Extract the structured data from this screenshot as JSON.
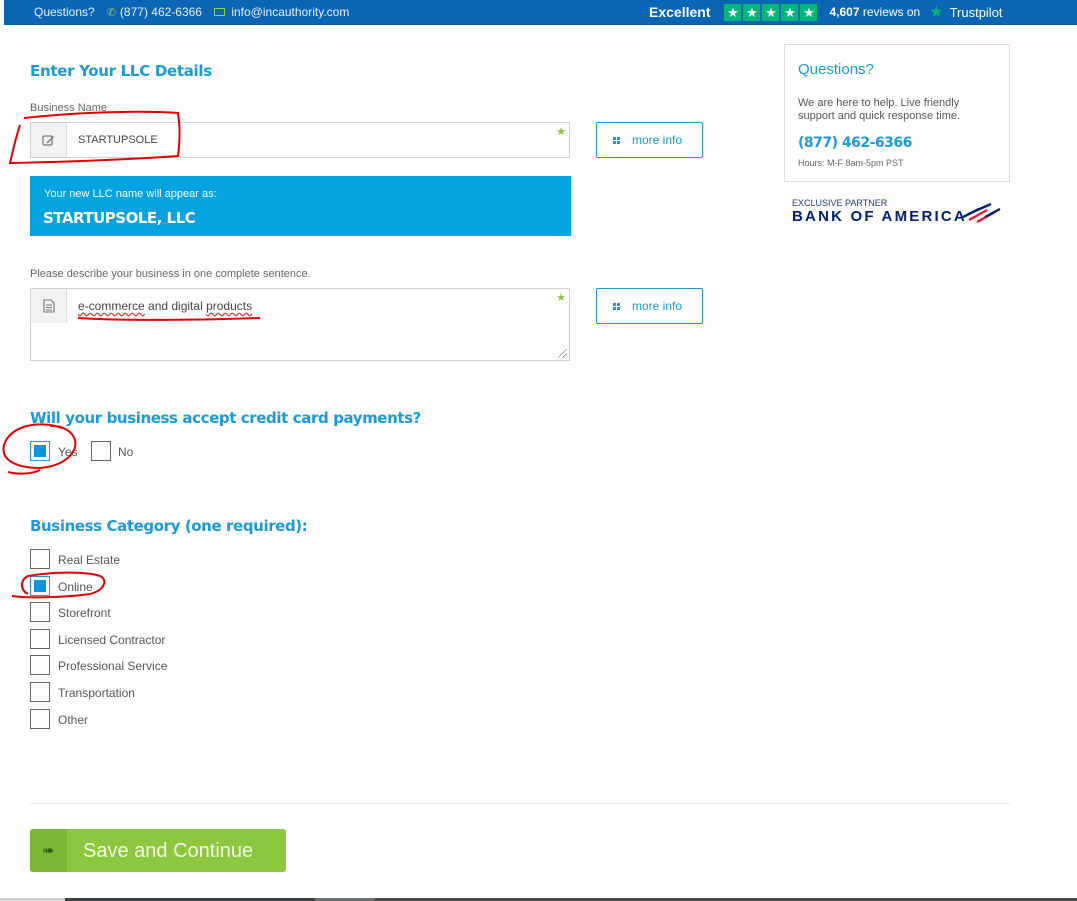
{
  "topbar": {
    "questions": "Questions?",
    "phone": "(877) 462-6366",
    "email": "info@incauthority.com",
    "rating_word": "Excellent",
    "star_count": 5,
    "reviews_count": "4,607",
    "reviews_suffix": "reviews on",
    "trustpilot": "Trustpilot"
  },
  "form": {
    "title": "Enter Your LLC Details",
    "business_name": {
      "label": "Business Name",
      "value": "STARTUPSOLE",
      "more_info": "more info"
    },
    "preview": {
      "caption": "Your new LLC name will appear as:",
      "name": "STARTUPSOLE, LLC"
    },
    "description": {
      "label": "Please describe your business in one complete sentence.",
      "value_parts": [
        "e-commerce",
        " and digital ",
        "products"
      ],
      "more_info": "more info"
    },
    "credit_card": {
      "question": "Will your business accept credit card payments?",
      "options": [
        {
          "label": "Yes",
          "checked": true
        },
        {
          "label": "No",
          "checked": false
        }
      ]
    },
    "category": {
      "heading": "Business Category (one required):",
      "options": [
        {
          "label": "Real Estate",
          "checked": false
        },
        {
          "label": "Online",
          "checked": true
        },
        {
          "label": "Storefront",
          "checked": false
        },
        {
          "label": "Licensed Contractor",
          "checked": false
        },
        {
          "label": "Professional Service",
          "checked": false
        },
        {
          "label": "Transportation",
          "checked": false
        },
        {
          "label": "Other",
          "checked": false
        }
      ]
    },
    "save_label": "Save and Continue"
  },
  "sidebar": {
    "heading": "Questions?",
    "text": "We are here to help. Live friendly support and quick response time.",
    "phone": "(877) 462-6366",
    "hours": "Hours: M-F 8am-5pm PST",
    "partner_caption": "EXCLUSIVE PARTNER",
    "partner_name": "BANK OF AMERICA"
  },
  "colors": {
    "brand_blue": "#0a66b5",
    "accent_blue": "#1a9ad6",
    "preview_bg": "#02a3e0",
    "save_green": "#8dc63f",
    "trustpilot_green": "#00b67a",
    "annotation_red": "#e00000"
  }
}
